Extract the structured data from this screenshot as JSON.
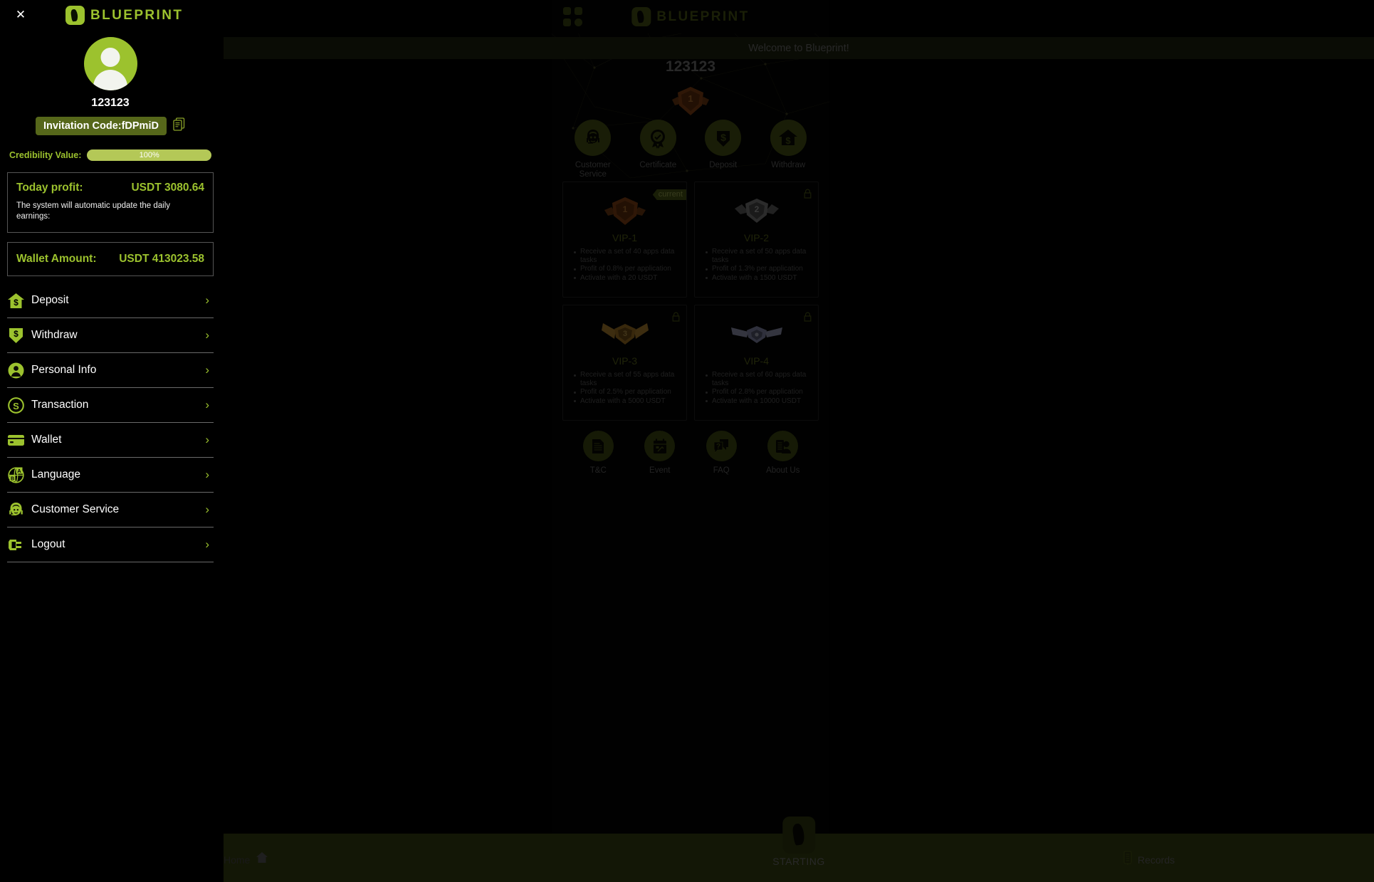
{
  "app": {
    "header": {
      "grid_icon": "grid-icon",
      "logo_text": "BLUEPRINT"
    },
    "username": "123123",
    "vip_crest_level": "1",
    "quick_actions": [
      {
        "label": "Customer\nService",
        "icon": "customer-service-icon"
      },
      {
        "label": "Certificate",
        "icon": "certificate-icon"
      },
      {
        "label": "Deposit",
        "icon": "deposit-icon"
      },
      {
        "label": "Withdraw",
        "icon": "withdraw-icon"
      }
    ],
    "quick_action_labels": {
      "customer_service_line1": "Customer",
      "customer_service_line2": "Service",
      "certificate": "Certificate",
      "deposit": "Deposit",
      "withdraw": "Withdraw"
    },
    "vip_cards": [
      {
        "title": "VIP-1",
        "tag": "current",
        "locked": false,
        "features": [
          "Receive a set of 40 apps data tasks",
          "Profit of 0.8% per application",
          "Activate with a 20 USDT"
        ]
      },
      {
        "title": "VIP-2",
        "tag": "",
        "locked": true,
        "features": [
          "Receive a set of 50 apps data tasks",
          "Profit of 1.3% per application",
          "Activate with a 1500 USDT"
        ]
      },
      {
        "title": "VIP-3",
        "tag": "",
        "locked": true,
        "features": [
          "Receive a set of 55 apps data tasks",
          "Profit of 2.5% per application",
          "Activate with a 5000 USDT"
        ]
      },
      {
        "title": "VIP-4",
        "tag": "",
        "locked": true,
        "features": [
          "Receive a set of 60 apps data tasks",
          "Profit of 2.8% per application",
          "Activate with a 10000 USDT"
        ]
      }
    ],
    "info_links": [
      {
        "label": "T&C",
        "icon": "document-icon"
      },
      {
        "label": "Event",
        "icon": "calendar-icon"
      },
      {
        "label": "FAQ",
        "icon": "faq-chat-icon"
      },
      {
        "label": "About Us",
        "icon": "about-us-icon"
      }
    ]
  },
  "banner": {
    "text": "Welcome to Blueprint!"
  },
  "bottom_nav": {
    "home_label": "Home",
    "center_label": "STARTING",
    "records_label": "Records"
  },
  "sidebar": {
    "close_label": "✕",
    "logo_text": "BLUEPRINT",
    "username": "123123",
    "invitation_code": "Invitation Code:fDPmiD",
    "copy_icon": "copy-icon",
    "credibility_label": "Credibility Value:",
    "credibility_value": "100%",
    "today_profit_label": "Today profit:",
    "today_profit_value": "USDT 3080.64",
    "today_profit_note": "The system will automatic update the daily earnings:",
    "wallet_label": "Wallet Amount:",
    "wallet_value": "USDT 413023.58",
    "menu": [
      {
        "label": "Deposit",
        "icon": "deposit-house-icon"
      },
      {
        "label": "Withdraw",
        "icon": "withdraw-arrow-icon"
      },
      {
        "label": "Personal Info",
        "icon": "person-icon"
      },
      {
        "label": "Transaction",
        "icon": "transaction-coin-icon"
      },
      {
        "label": "Wallet",
        "icon": "card-icon"
      },
      {
        "label": "Language",
        "icon": "globe-language-icon"
      },
      {
        "label": "Customer Service",
        "icon": "support-agent-icon"
      },
      {
        "label": "Logout",
        "icon": "logout-icon"
      }
    ],
    "chevron": "›"
  },
  "colors": {
    "brand_green": "#9cc22e",
    "dark_green": "#56671a",
    "nav_green": "#465418",
    "banner_green": "#262d12"
  }
}
